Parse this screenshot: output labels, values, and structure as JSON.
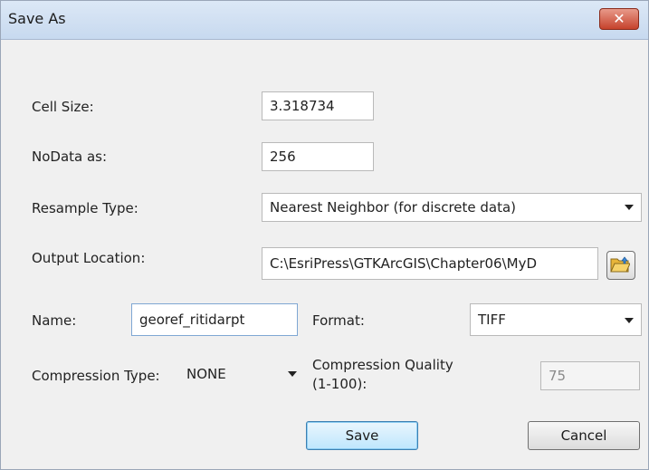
{
  "window": {
    "title": "Save As",
    "close_label": "✕"
  },
  "fields": {
    "cell_size_label": "Cell Size:",
    "cell_size_value": "3.318734",
    "nodata_label": "NoData as:",
    "nodata_value": "256",
    "resample_label": "Resample Type:",
    "resample_value": "Nearest Neighbor (for discrete data)",
    "output_location_label": "Output Location:",
    "output_location_value": "C:\\EsriPress\\GTKArcGIS\\Chapter06\\MyD",
    "name_label": "Name:",
    "name_value": "georef_ritidarpt",
    "format_label": "Format:",
    "format_value": "TIFF",
    "compression_type_label": "Compression Type:",
    "compression_type_value": "NONE",
    "compression_quality_label_1": "Compression Quality",
    "compression_quality_label_2": "(1-100):",
    "compression_quality_value": "75"
  },
  "buttons": {
    "save": "Save",
    "cancel": "Cancel"
  },
  "icons": {
    "browse": "folder-open-icon",
    "close": "close-icon",
    "dropdown": "chevron-down-icon"
  },
  "colors": {
    "title_bar": "#c7d9ef",
    "close_button": "#c6422c",
    "default_button": "#bee6fd"
  }
}
